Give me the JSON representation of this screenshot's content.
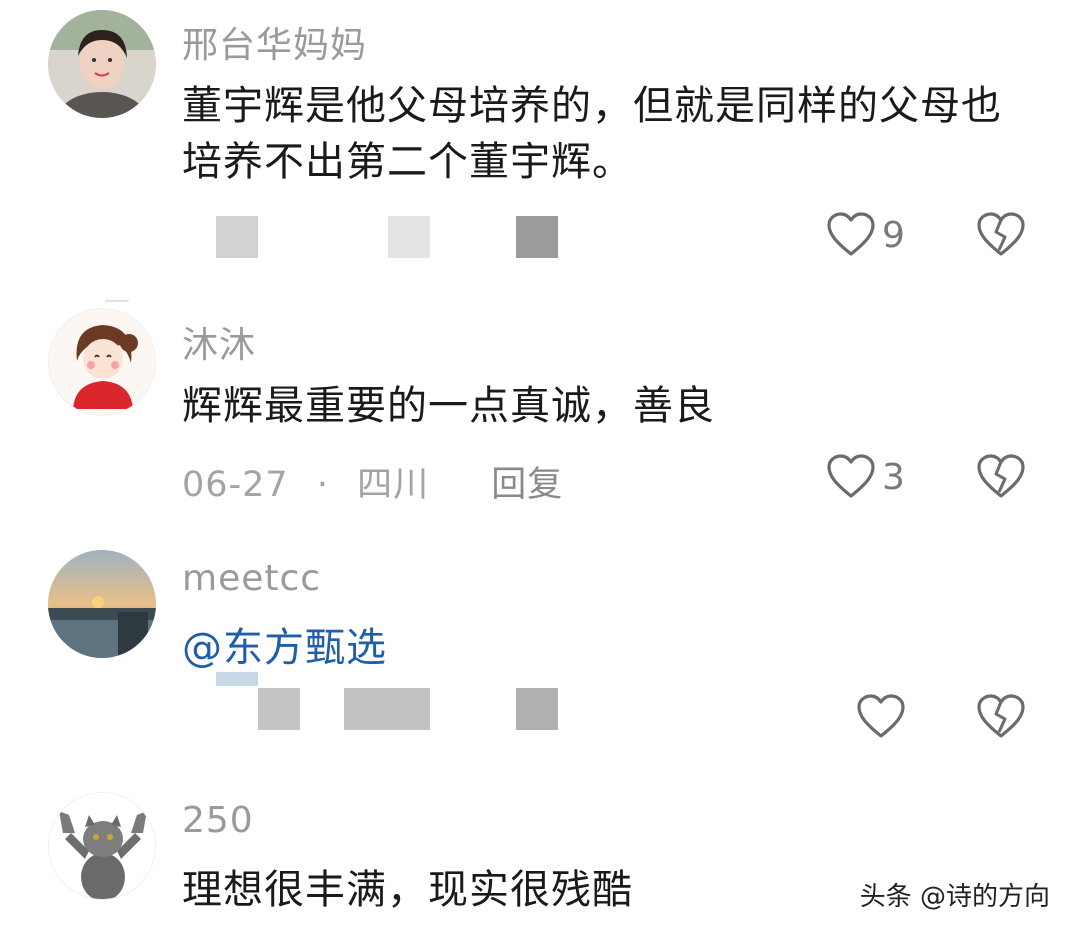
{
  "comments": [
    {
      "username": "邢台华妈妈",
      "text": "董宇辉是他父母培养的，但就是同样的父母也培养不出第二个董宇辉。",
      "likes": "9"
    },
    {
      "username": "沐沐",
      "text": "辉辉最重要的一点真诚，善良",
      "date": "06-27",
      "separator": "·",
      "location": "四川",
      "reply_label": "回复",
      "likes": "3"
    },
    {
      "username": "meetcc",
      "text": "@东方甄选",
      "likes": ""
    },
    {
      "username": "250",
      "text": "理想很丰满，现实很残酷"
    }
  ],
  "watermark": "头条 @诗的方向",
  "colors": {
    "username": "#9a9a9a",
    "text": "#1a1a1a",
    "mention": "#1f5fa8",
    "meta": "#a3a3a3",
    "icon": "#6b6b6b"
  },
  "icons": [
    "heart-outline-icon",
    "broken-heart-icon"
  ]
}
